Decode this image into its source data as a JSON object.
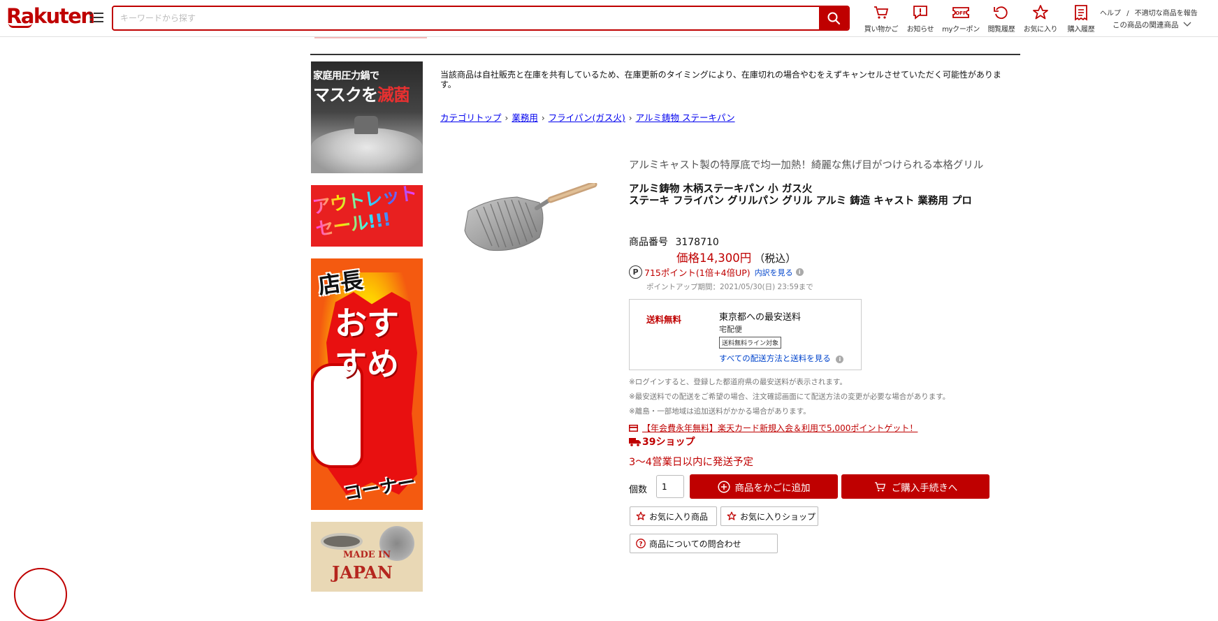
{
  "header": {
    "logo": "Rakuten",
    "search_placeholder": "キーワードから探す",
    "nav": [
      {
        "label": "買い物かご",
        "icon": "cart-icon"
      },
      {
        "label": "お知らせ",
        "icon": "notification-icon"
      },
      {
        "label": "myクーポン",
        "icon": "coupon-icon"
      },
      {
        "label": "閲覧履歴",
        "icon": "history-icon"
      },
      {
        "label": "お気に入り",
        "icon": "star-icon"
      },
      {
        "label": "購入履歴",
        "icon": "receipt-icon"
      }
    ],
    "help": "ヘルプ",
    "help_sep": "/",
    "report": "不適切な商品を報告",
    "related": "この商品の関連商品",
    "coupon_icon_text": "OFF"
  },
  "banners": {
    "b1_line1": "家庭用圧力鍋で",
    "b1_line2a": "マスクを",
    "b1_line2b": "滅菌",
    "b2_text": "アウトレット\nセール!!!",
    "b3_top": "店長",
    "b3_mid": "おす\nすめ",
    "b3_bot": "コーナー",
    "b4_made": "MADE IN",
    "b4_japan": "JAPAN"
  },
  "notice": "当該商品は自社販売と在庫を共有しているため、在庫更新のタイミングにより、在庫切れの場合やむをえずキャンセルさせていただく可能性があります。",
  "breadcrumb": [
    "カテゴリトップ",
    "業務用",
    "フライパン(ガス火)",
    "アルミ鋳物 ステーキパン"
  ],
  "product": {
    "catch_copy": "アルミキャスト製の特厚底で均一加熱！綺麗な焦げ目がつけられる本格グリル",
    "name": "アルミ鋳物 木柄ステーキパン 小 ガス火\nステーキ フライパン グリルパン グリル アルミ 鋳造 キャスト 業務用 プロ",
    "number_label": "商品番号",
    "number": "3178710",
    "price": "価格14,300円",
    "tax": "（税込）",
    "point_symbol": "P",
    "points": "715ポイント(1倍+4倍UP)",
    "points_link": "内訳を見る",
    "point_period": "ポイントアップ期間：2021/05/30(日) 23:59まで"
  },
  "shipping": {
    "free": "送料無料",
    "title": "東京都への最安送料",
    "method": "宅配便",
    "badge": "送料無料ライン対象",
    "link": "すべての配送方法と送料を見る"
  },
  "notes": [
    "※ログインすると、登録した都道府県の最安送料が表示されます。",
    "※最安送料での配送をご希望の場合、注文確認画面にて配送方法の変更が必要な場合があります。",
    "※離島・一部地域は追加送料がかかる場合があります。"
  ],
  "promo": {
    "card": "【年会費永年無料】楽天カード新規入会＆利用で5,000ポイントゲット！",
    "shop39": "39ショップ",
    "ship_time": "3〜4営業日以内に発送予定"
  },
  "purchase": {
    "qty_label": "個数",
    "qty_value": "1",
    "add_cart": "商品をかごに追加",
    "buy_now": "ご購入手続きへ",
    "fav_item": "お気に入り商品",
    "fav_shop": "お気に入りショップ",
    "inquiry": "商品についての問合わせ"
  },
  "colors": {
    "brand_red": "#bf0000",
    "link_blue": "#0044cc"
  }
}
